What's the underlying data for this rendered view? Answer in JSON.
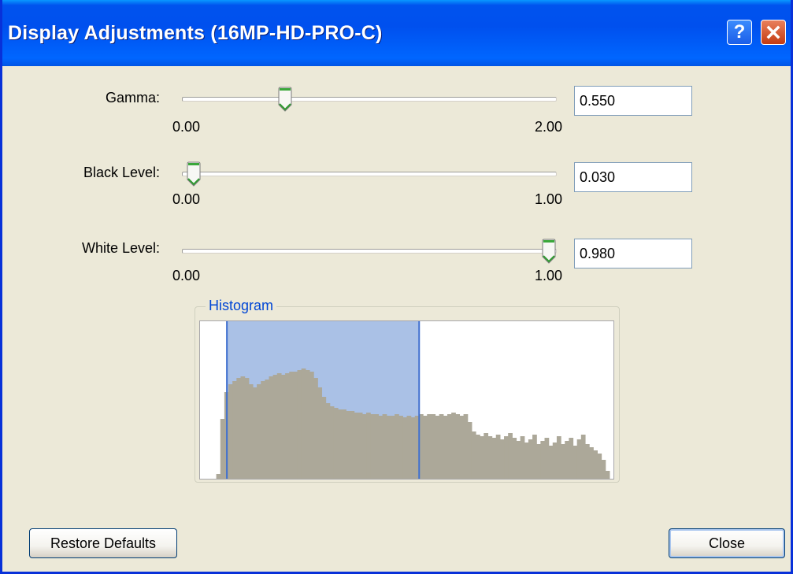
{
  "window": {
    "title": "Display Adjustments (16MP-HD-PRO-C)",
    "help_icon_char": "?",
    "colors": {
      "titlebar": "#0053ee",
      "face": "#ece9d8",
      "close_button": "#c43b12",
      "histogram_fill": "#aca899",
      "histogram_highlight": "#aac1e6",
      "histogram_marker": "#3f6fcf",
      "legend_text": "#0046d5"
    }
  },
  "sliders": [
    {
      "label": "Gamma:",
      "min_label": "0.00",
      "max_label": "2.00",
      "value": "0.550",
      "level": 0.275
    },
    {
      "label": "Black Level:",
      "min_label": "0.00",
      "max_label": "1.00",
      "value": "0.030",
      "level": 0.03
    },
    {
      "label": "White Level:",
      "min_label": "0.00",
      "max_label": "1.00",
      "value": "0.980",
      "level": 0.98
    }
  ],
  "histogram": {
    "label": "Histogram",
    "selection_range": [
      0.065,
      0.53
    ],
    "bins": [
      0,
      0,
      0,
      0,
      0.03,
      0.38,
      0.55,
      0.6,
      0.62,
      0.64,
      0.65,
      0.64,
      0.6,
      0.58,
      0.6,
      0.62,
      0.63,
      0.65,
      0.66,
      0.67,
      0.66,
      0.67,
      0.68,
      0.68,
      0.69,
      0.7,
      0.69,
      0.68,
      0.64,
      0.58,
      0.52,
      0.48,
      0.46,
      0.45,
      0.44,
      0.44,
      0.43,
      0.43,
      0.42,
      0.42,
      0.41,
      0.42,
      0.41,
      0.41,
      0.4,
      0.41,
      0.4,
      0.4,
      0.41,
      0.4,
      0.39,
      0.4,
      0.39,
      0.4,
      0.41,
      0.4,
      0.41,
      0.41,
      0.4,
      0.41,
      0.4,
      0.41,
      0.42,
      0.41,
      0.4,
      0.41,
      0.36,
      0.3,
      0.28,
      0.27,
      0.29,
      0.27,
      0.26,
      0.28,
      0.25,
      0.27,
      0.29,
      0.26,
      0.24,
      0.27,
      0.23,
      0.25,
      0.28,
      0.22,
      0.24,
      0.26,
      0.21,
      0.23,
      0.27,
      0.22,
      0.24,
      0.26,
      0.21,
      0.25,
      0.28,
      0.22,
      0.2,
      0.18,
      0.16,
      0.12,
      0.05,
      0
    ]
  },
  "buttons": {
    "restore_label": "Restore Defaults",
    "close_label": "Close"
  }
}
